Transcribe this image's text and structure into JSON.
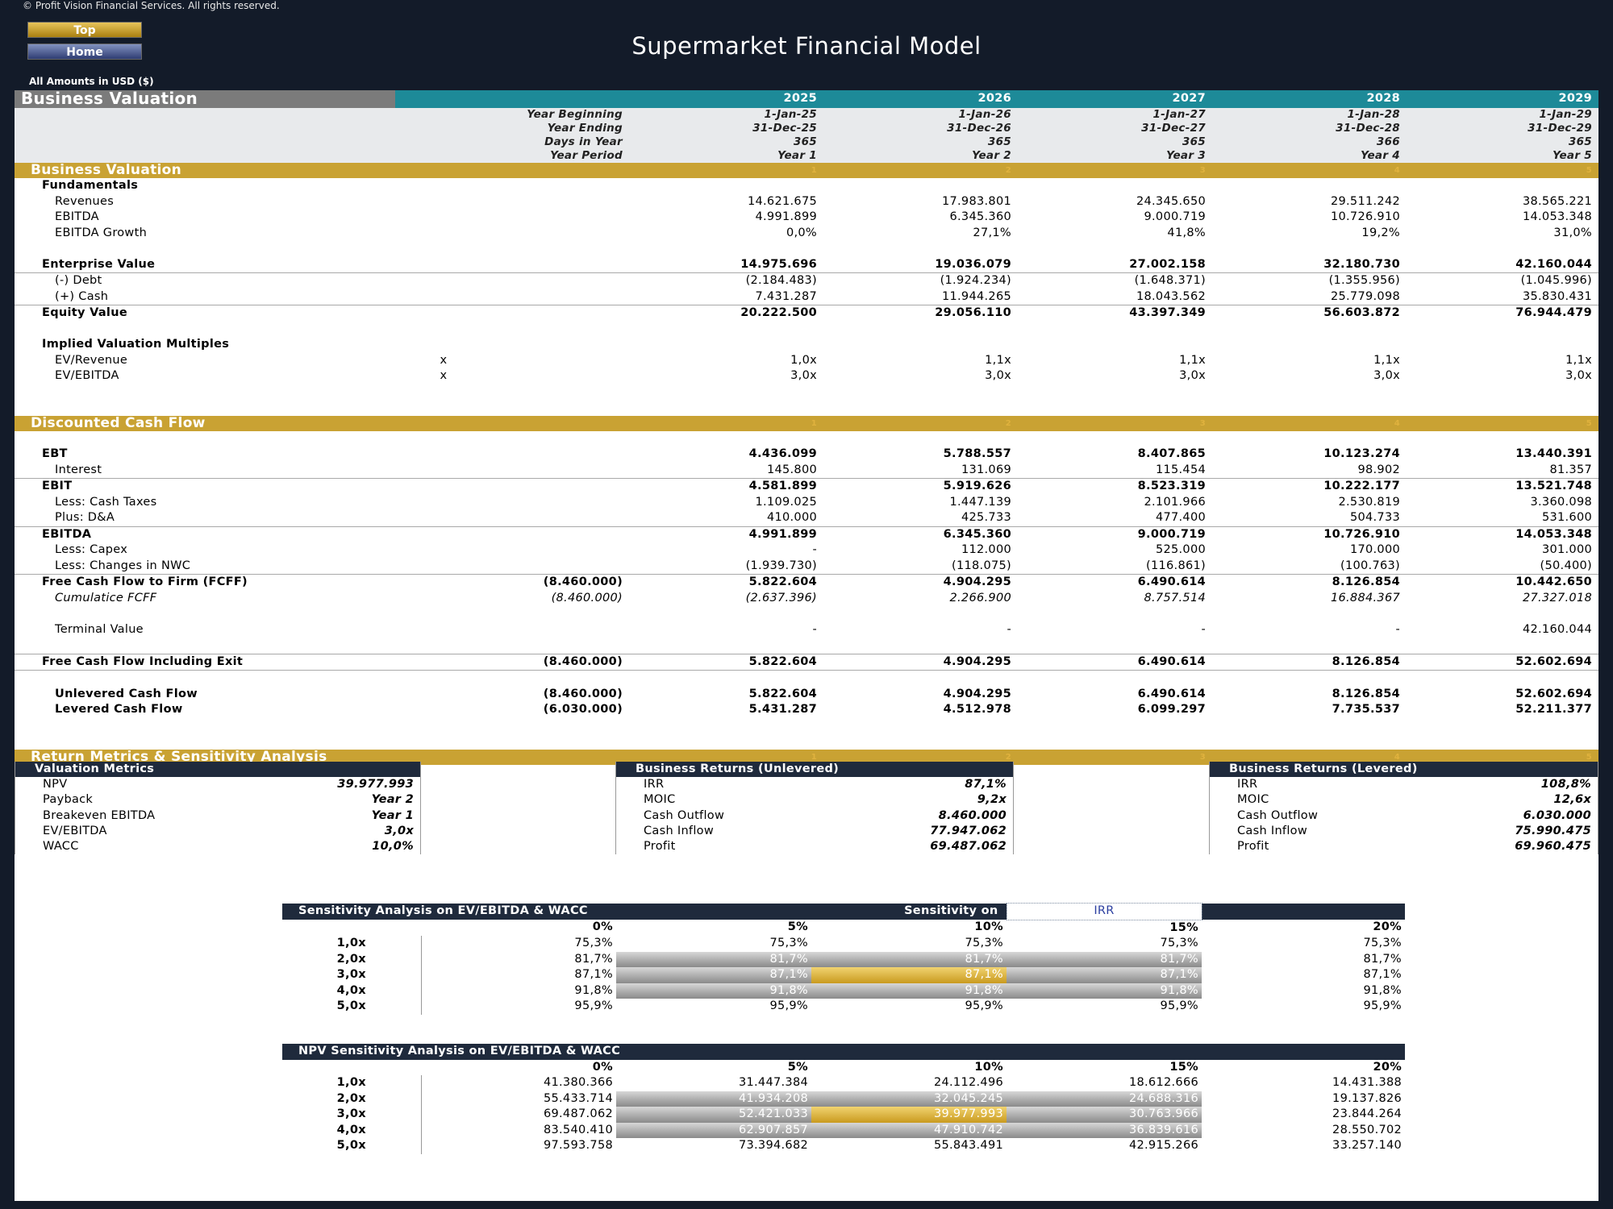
{
  "copyright": "© Profit Vision Financial Services. All rights reserved.",
  "nav": {
    "top": "Top",
    "home": "Home"
  },
  "title": "Supermarket Financial Model",
  "amounts_note": "All Amounts in  USD ($)",
  "header": {
    "label": "Business Valuation",
    "years": [
      "2025",
      "2026",
      "2027",
      "2028",
      "2029"
    ],
    "rows": [
      {
        "label": "Year Beginning",
        "values": [
          "1-Jan-25",
          "1-Jan-26",
          "1-Jan-27",
          "1-Jan-28",
          "1-Jan-29"
        ]
      },
      {
        "label": "Year Ending",
        "values": [
          "31-Dec-25",
          "31-Dec-26",
          "31-Dec-27",
          "31-Dec-28",
          "31-Dec-29"
        ]
      },
      {
        "label": "Days in Year",
        "values": [
          "365",
          "365",
          "365",
          "366",
          "365"
        ]
      },
      {
        "label": "Year Period",
        "values": [
          "Year 1",
          "Year 2",
          "Year 3",
          "Year 4",
          "Year 5"
        ]
      }
    ]
  },
  "section_bv": {
    "title": "Business Valuation",
    "fundamentals": "Fundamentals",
    "revenues": {
      "label": "Revenues",
      "values": [
        "14.621.675",
        "17.983.801",
        "24.345.650",
        "29.511.242",
        "38.565.221"
      ]
    },
    "ebitda": {
      "label": "EBITDA",
      "values": [
        "4.991.899",
        "6.345.360",
        "9.000.719",
        "10.726.910",
        "14.053.348"
      ]
    },
    "ebitda_growth": {
      "label": "EBITDA Growth",
      "values": [
        "0,0%",
        "27,1%",
        "41,8%",
        "19,2%",
        "31,0%"
      ]
    },
    "ev": {
      "label": "Enterprise Value",
      "values": [
        "14.975.696",
        "19.036.079",
        "27.002.158",
        "32.180.730",
        "42.160.044"
      ]
    },
    "debt": {
      "label": "(-) Debt",
      "values": [
        "(2.184.483)",
        "(1.924.234)",
        "(1.648.371)",
        "(1.355.956)",
        "(1.045.996)"
      ]
    },
    "cash": {
      "label": "(+) Cash",
      "values": [
        "7.431.287",
        "11.944.265",
        "18.043.562",
        "25.779.098",
        "35.830.431"
      ]
    },
    "equity": {
      "label": "Equity Value",
      "values": [
        "20.222.500",
        "29.056.110",
        "43.397.349",
        "56.603.872",
        "76.944.479"
      ]
    },
    "multiples": "Implied Valuation Multiples",
    "ev_rev": {
      "label": "EV/Revenue",
      "unit": "x",
      "values": [
        "1,0x",
        "1,1x",
        "1,1x",
        "1,1x",
        "1,1x"
      ]
    },
    "ev_ebitda": {
      "label": "EV/EBITDA",
      "unit": "x",
      "values": [
        "3,0x",
        "3,0x",
        "3,0x",
        "3,0x",
        "3,0x"
      ]
    }
  },
  "section_dcf": {
    "title": "Discounted Cash Flow",
    "ebt": {
      "label": "EBT",
      "values": [
        "4.436.099",
        "5.788.557",
        "8.407.865",
        "10.123.274",
        "13.440.391"
      ]
    },
    "interest": {
      "label": "Interest",
      "values": [
        "145.800",
        "131.069",
        "115.454",
        "98.902",
        "81.357"
      ]
    },
    "ebit": {
      "label": "EBIT",
      "values": [
        "4.581.899",
        "5.919.626",
        "8.523.319",
        "10.222.177",
        "13.521.748"
      ]
    },
    "taxes": {
      "label": "Less: Cash Taxes",
      "values": [
        "1.109.025",
        "1.447.139",
        "2.101.966",
        "2.530.819",
        "3.360.098"
      ]
    },
    "da": {
      "label": "Plus: D&A",
      "values": [
        "410.000",
        "425.733",
        "477.400",
        "504.733",
        "531.600"
      ]
    },
    "ebitda": {
      "label": "EBITDA",
      "values": [
        "4.991.899",
        "6.345.360",
        "9.000.719",
        "10.726.910",
        "14.053.348"
      ]
    },
    "capex": {
      "label": "Less: Capex",
      "values": [
        "-",
        "112.000",
        "525.000",
        "170.000",
        "301.000"
      ]
    },
    "nwc": {
      "label": "Less: Changes in NWC",
      "values": [
        "(1.939.730)",
        "(118.075)",
        "(116.861)",
        "(100.763)",
        "(50.400)"
      ]
    },
    "fcff": {
      "label": "Free Cash Flow to Firm (FCFF)",
      "initial": "(8.460.000)",
      "values": [
        "5.822.604",
        "4.904.295",
        "6.490.614",
        "8.126.854",
        "10.442.650"
      ]
    },
    "cum": {
      "label": "Cumulatice FCFF",
      "initial": "(8.460.000)",
      "values": [
        "(2.637.396)",
        "2.266.900",
        "8.757.514",
        "16.884.367",
        "27.327.018"
      ]
    },
    "tv": {
      "label": "Terminal Value",
      "values": [
        "-",
        "-",
        "-",
        "-",
        "42.160.044"
      ]
    },
    "fcf_exit": {
      "label": "Free Cash Flow Including Exit",
      "initial": "(8.460.000)",
      "values": [
        "5.822.604",
        "4.904.295",
        "6.490.614",
        "8.126.854",
        "52.602.694"
      ]
    },
    "unlev": {
      "label": "Unlevered Cash Flow",
      "initial": "(8.460.000)",
      "values": [
        "5.822.604",
        "4.904.295",
        "6.490.614",
        "8.126.854",
        "52.602.694"
      ]
    },
    "lev": {
      "label": "Levered Cash Flow",
      "initial": "(6.030.000)",
      "values": [
        "5.431.287",
        "4.512.978",
        "6.099.297",
        "7.735.537",
        "52.211.377"
      ]
    }
  },
  "section_rm": {
    "title": "Return Metrics & Sensitivity Analysis",
    "valuation": {
      "title": "Valuation Metrics",
      "rows": [
        [
          "NPV",
          "39.977.993"
        ],
        [
          "Payback",
          "Year 2"
        ],
        [
          "Breakeven EBITDA",
          "Year 1"
        ],
        [
          "EV/EBITDA",
          "3,0x"
        ],
        [
          "WACC",
          "10,0%"
        ]
      ]
    },
    "unlevered": {
      "title": "Business Returns (Unlevered)",
      "rows": [
        [
          "IRR",
          "87,1%"
        ],
        [
          "MOIC",
          "9,2x"
        ],
        [
          "Cash Outflow",
          "8.460.000"
        ],
        [
          "Cash Inflow",
          "77.947.062"
        ],
        [
          "Profit",
          "69.487.062"
        ]
      ]
    },
    "levered": {
      "title": "Business Returns (Levered)",
      "rows": [
        [
          "IRR",
          "108,8%"
        ],
        [
          "MOIC",
          "12,6x"
        ],
        [
          "Cash Outflow",
          "6.030.000"
        ],
        [
          "Cash Inflow",
          "75.990.475"
        ],
        [
          "Profit",
          "69.960.475"
        ]
      ]
    }
  },
  "sens1": {
    "title": "Sensitivity Analysis on EV/EBITDA & WACC",
    "on_label": "Sensitivity on",
    "on_value": "IRR",
    "cols": [
      "0%",
      "5%",
      "10%",
      "15%",
      "20%"
    ],
    "rows": [
      {
        "label": "1,0x",
        "values": [
          "75,3%",
          "75,3%",
          "75,3%",
          "75,3%",
          "75,3%"
        ]
      },
      {
        "label": "2,0x",
        "values": [
          "81,7%",
          "81,7%",
          "81,7%",
          "81,7%",
          "81,7%"
        ]
      },
      {
        "label": "3,0x",
        "values": [
          "87,1%",
          "87,1%",
          "87,1%",
          "87,1%",
          "87,1%"
        ]
      },
      {
        "label": "4,0x",
        "values": [
          "91,8%",
          "91,8%",
          "91,8%",
          "91,8%",
          "91,8%"
        ]
      },
      {
        "label": "5,0x",
        "values": [
          "95,9%",
          "95,9%",
          "95,9%",
          "95,9%",
          "95,9%"
        ]
      }
    ]
  },
  "sens2": {
    "title": "NPV Sensitivity Analysis on EV/EBITDA & WACC",
    "cols": [
      "0%",
      "5%",
      "10%",
      "15%",
      "20%"
    ],
    "rows": [
      {
        "label": "1,0x",
        "values": [
          "41.380.366",
          "31.447.384",
          "24.112.496",
          "18.612.666",
          "14.431.388"
        ]
      },
      {
        "label": "2,0x",
        "values": [
          "55.433.714",
          "41.934.208",
          "32.045.245",
          "24.688.316",
          "19.137.826"
        ]
      },
      {
        "label": "3,0x",
        "values": [
          "69.487.062",
          "52.421.033",
          "39.977.993",
          "30.763.966",
          "23.844.264"
        ]
      },
      {
        "label": "4,0x",
        "values": [
          "83.540.410",
          "62.907.857",
          "47.910.742",
          "36.839.616",
          "28.550.702"
        ]
      },
      {
        "label": "5,0x",
        "values": [
          "97.593.758",
          "73.394.682",
          "55.843.491",
          "42.915.266",
          "33.257.140"
        ]
      }
    ]
  }
}
